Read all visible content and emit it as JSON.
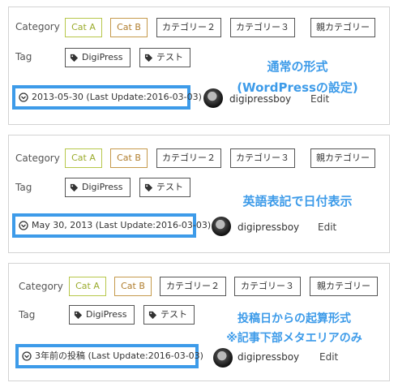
{
  "colors": {
    "accent": "#3d9be9",
    "cat_a": "#9aab2c",
    "cat_b": "#b07d2d"
  },
  "panels": [
    {
      "category_label": "Category",
      "categories": [
        "Cat A",
        "Cat B",
        "カテゴリー２",
        "カテゴリー３",
        "親カテゴリー"
      ],
      "tag_label": "Tag",
      "tags": [
        "DigiPress",
        "テスト"
      ],
      "date_text": "2013-05-30 (Last Update:2016-03-03)",
      "author": "digipressboy",
      "edit_label": "Edit",
      "note_lines": [
        "通常の形式",
        "(WordPressの設定)"
      ]
    },
    {
      "category_label": "Category",
      "categories": [
        "Cat A",
        "Cat B",
        "カテゴリー２",
        "カテゴリー３",
        "親カテゴリー"
      ],
      "tag_label": "Tag",
      "tags": [
        "DigiPress",
        "テスト"
      ],
      "date_text": "May 30, 2013 (Last Update:2016-03-03)",
      "author": "digipressboy",
      "edit_label": "Edit",
      "note_lines": [
        "英語表記で日付表示"
      ]
    },
    {
      "category_label": "Category",
      "categories": [
        "Cat A",
        "Cat B",
        "カテゴリー２",
        "カテゴリー３",
        "親カテゴリー"
      ],
      "tag_label": "Tag",
      "tags": [
        "DigiPress",
        "テスト"
      ],
      "date_text": "3年前の投稿 (Last Update:2016-03-03)",
      "author": "digipressboy",
      "edit_label": "Edit",
      "note_lines": [
        "投稿日からの起算形式",
        "※記事下部メタエリアのみ"
      ]
    }
  ]
}
